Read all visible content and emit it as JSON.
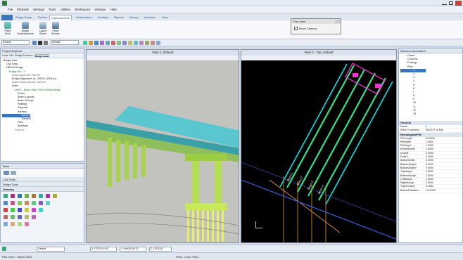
{
  "menu": [
    "File",
    "Element",
    "Settings",
    "Tools",
    "Utilities",
    "Workspace",
    "Window",
    "Help"
  ],
  "ribbon_tabs": [
    "Bridge Setup",
    "Prelims",
    "Superstructure",
    "Substructure",
    "Auxiliary",
    "Reports",
    "Interop",
    "Libraries",
    "View"
  ],
  "ribbon_buttons": [
    {
      "label": "Place Deck"
    },
    {
      "label": "Assign Superstructure"
    },
    {
      "label": "Layout Beam"
    },
    {
      "label": "Place Beams"
    }
  ],
  "pan_view": {
    "title": "Pan View",
    "checkbox_label": "Move Camera"
  },
  "toolbar2": {
    "level_value": "Default",
    "level_value_2": "Default"
  },
  "project_explorer": {
    "title": "Project Explorer",
    "tabs": [
      "Links",
      "File",
      "Bridge Features",
      "Bridge Data"
    ],
    "tree": [
      "Bridge Data",
      "Civil Data",
      "OBCivil Bridge",
      "Bridge BR 1 1",
      "Road Alignment: Not Set",
      "Bridge Alignment: AL_SPEN_DSHULA",
      "Active Terrain Model: Not Set",
      "Units",
      "Unit 1 - Beam Slab: Steel Girders Bridg",
      "Decks",
      "Beam Layouts",
      "Beam Groups",
      "Railings",
      "Supports",
      "Barriers",
      "Barrier1",
      "Barrier2",
      "Piers",
      "Bearings",
      "Reports"
    ]
  },
  "tasks": {
    "title": "Tasks",
    "sections": [
      "Civil Tools",
      "Bridge Tools",
      "Drawing"
    ]
  },
  "view1": {
    "title": "View 1, Default"
  },
  "view2": {
    "title": "View 2 - Top, Default",
    "beam_labels": [
      "Beam 1",
      "Beam 2",
      "Beam 3",
      "Beam 4"
    ]
  },
  "element_info": {
    "title": "Element Information",
    "tree": [
      "Cases",
      "Columns",
      "Footings",
      "Piles",
      "1",
      "2",
      "3",
      "4",
      "5",
      "6",
      "7",
      "8",
      "9",
      "10",
      "11",
      "12",
      "13"
    ],
    "general_header": "General",
    "general": [
      {
        "k": "Name",
        "v": "0"
      },
      {
        "k": "Isthis: Properties",
        "v": "SELECT to Edit"
      }
    ],
    "rect_header": "RectangularPile",
    "rect": [
      {
        "k": "PileLength",
        "v": "29.9999"
      },
      {
        "k": "PileWidth",
        "v": "1.5000"
      },
      {
        "k": "PileDepth",
        "v": "1.5000"
      },
      {
        "k": "EmbedDepth",
        "v": "1.5000"
      },
      {
        "k": "Default",
        "v": "0.0000"
      },
      {
        "k": "DeltaY",
        "v": "0.0000"
      },
      {
        "k": "BottomWidth",
        "v": "0.0000"
      },
      {
        "k": "BottomAngleX",
        "v": "0.0000"
      },
      {
        "k": "BottomAngleY",
        "v": "0.0000"
      },
      {
        "k": "TopMargin",
        "v": "2.5000"
      },
      {
        "k": "BottomMargin",
        "v": "2.5000"
      },
      {
        "k": "LeftMargin",
        "v": "2.5000"
      },
      {
        "k": "RightMargin",
        "v": "2.5000"
      },
      {
        "k": "TopElevation",
        "v": "8.4682"
      },
      {
        "k": "BottomElevation",
        "v": "-21.5318"
      }
    ]
  },
  "bottombar": {
    "level": "Default",
    "x": "X 275224.9142",
    "y": "Y 499005.9470",
    "z": "Z 123.5241"
  },
  "status": {
    "left": "Pan View > Select View",
    "middle": "Pier1, Level: Piers"
  },
  "colors": {
    "accent": "#2d4f7c",
    "beam_green": "#2fe38a",
    "cyan": "#00e5e5",
    "magenta": "#ff2fd4",
    "orange": "#e09a3b"
  }
}
